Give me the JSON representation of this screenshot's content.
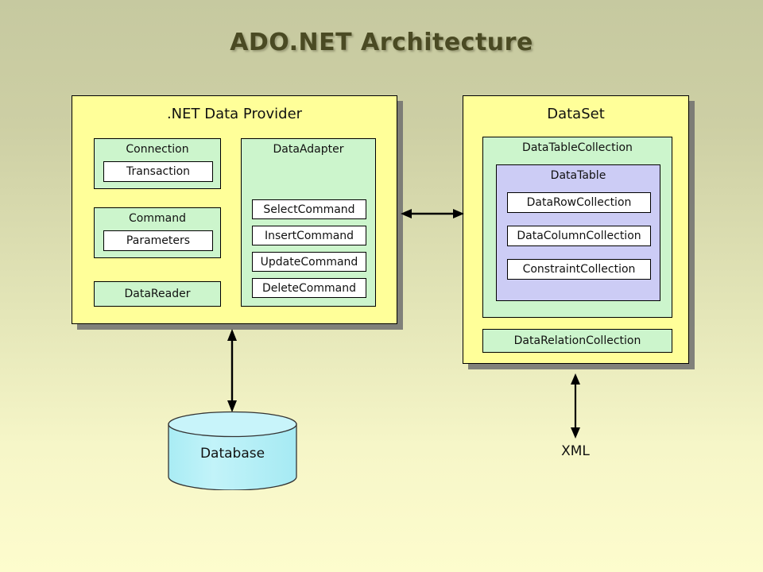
{
  "title": "ADO.NET Architecture",
  "colors": {
    "background_top": "#c6c9a0",
    "background_bottom": "#fdfccd",
    "panel_fill": "#ffff99",
    "group_fill": "#ccf5cc",
    "datatable_fill": "#ccccf5",
    "leaf_fill": "#ffffff",
    "database_fill": "#b5f0f7",
    "title_text": "#4a4a23",
    "stroke": "#000000",
    "shadow": "#6e6e6e"
  },
  "provider_panel": {
    "title": ".NET Data Provider",
    "connection": {
      "label": "Connection",
      "children": [
        "Transaction"
      ]
    },
    "command": {
      "label": "Command",
      "children": [
        "Parameters"
      ]
    },
    "datareader": {
      "label": "DataReader"
    },
    "dataadapter": {
      "label": "DataAdapter",
      "children": [
        "SelectCommand",
        "InsertCommand",
        "UpdateCommand",
        "DeleteCommand"
      ]
    }
  },
  "dataset_panel": {
    "title": "DataSet",
    "datatablecollection": {
      "label": "DataTableCollection",
      "datatable": {
        "label": "DataTable",
        "children": [
          "DataRowCollection",
          "DataColumnCollection",
          "ConstraintCollection"
        ]
      }
    },
    "datarelationcollection": {
      "label": "DataRelationCollection"
    }
  },
  "database": {
    "label": "Database"
  },
  "xml": {
    "label": "XML"
  },
  "connectors": {
    "provider_to_dataset": "double-headed-horizontal-arrow",
    "provider_to_database": "double-headed-vertical-arrow",
    "dataset_to_xml": "double-headed-vertical-arrow"
  }
}
